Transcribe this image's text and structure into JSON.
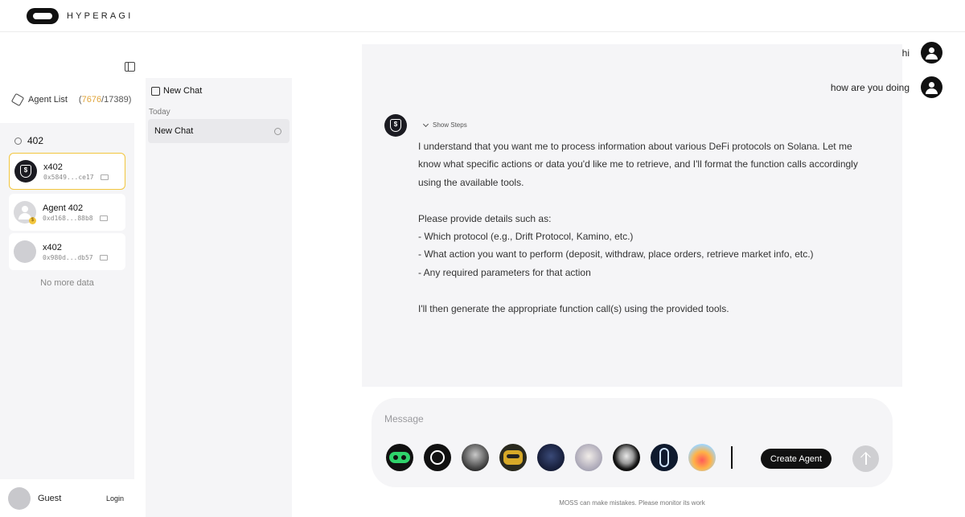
{
  "brand": {
    "name": "HYPERAGI"
  },
  "sidebar": {
    "agent_list_label": "Agent List",
    "count_open": "(",
    "count_highlight": "7676",
    "count_rest": "/17389)",
    "search_value": "402",
    "agents": [
      {
        "name": "x402",
        "address": "0x5849...ce17",
        "avatar": "shield-icon"
      },
      {
        "name": "Agent 402",
        "address": "0xd168...88b8",
        "avatar": "user-icon"
      },
      {
        "name": "x402",
        "address": "0x980d...db57",
        "avatar": "placeholder"
      }
    ],
    "no_more": "No more data"
  },
  "account": {
    "name": "Guest",
    "login_label": "Login"
  },
  "history": {
    "new_chat_label": "New Chat",
    "group_label": "Today",
    "items": [
      {
        "title": "New Chat"
      }
    ]
  },
  "conversation": {
    "messages": [
      {
        "role": "user",
        "text": "hi"
      },
      {
        "role": "user",
        "text": "how are you doing"
      }
    ],
    "show_steps_label": "Show Steps",
    "reply_lines": [
      "I understand that you want me to process information about various DeFi protocols on Solana. Let me know what specific actions or data you'd like me to retrieve, and I'll format the function calls accordingly using the available tools.",
      "",
      "Please provide details such as:",
      "- Which protocol (e.g., Drift Protocol, Kamino, etc.)",
      "- What action you want to perform (deposit, withdraw, place orders, retrieve market info, etc.)",
      "- Any required parameters for that action",
      "",
      "I'll then generate the appropriate function call(s) using the provided tools."
    ]
  },
  "composer": {
    "placeholder": "Message",
    "create_agent_label": "Create Agent",
    "bots": [
      "green-robot-icon",
      "hyper-logo-icon",
      "dark-portrait-icon",
      "yellow-robot-icon",
      "cat-portrait-icon",
      "white-hair-portrait-icon",
      "silver-head-icon",
      "agent-portrait-icon",
      "sunset-portrait-icon"
    ]
  },
  "footer": {
    "disclaimer": "MOSS can make mistakes. Please monitor its work"
  }
}
